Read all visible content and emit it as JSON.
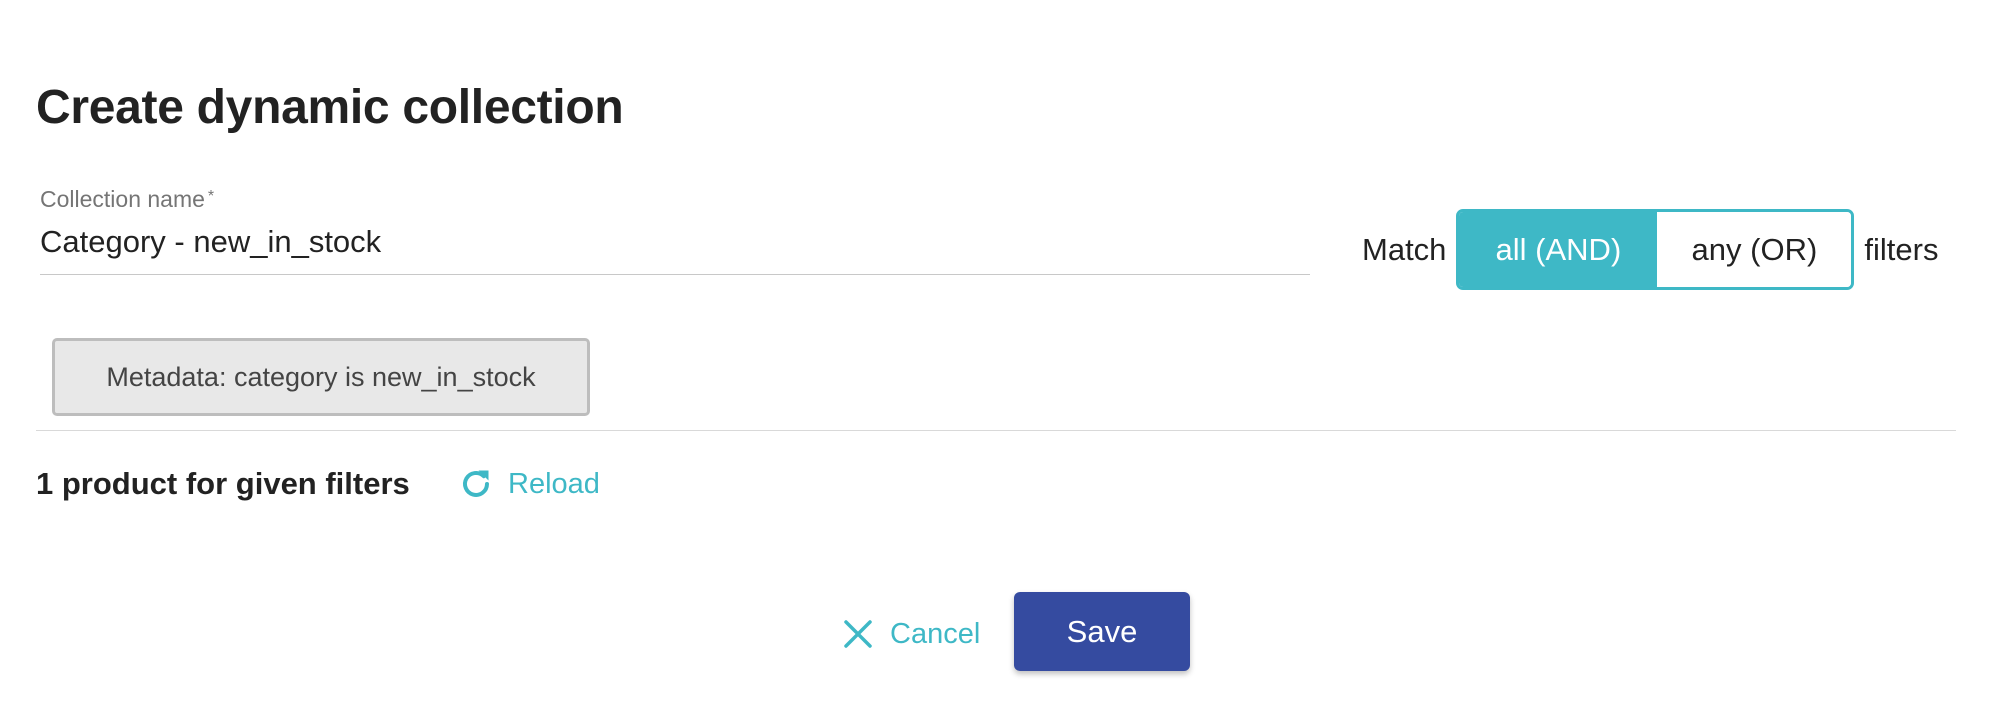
{
  "dialog": {
    "title": "Create dynamic collection"
  },
  "name_field": {
    "label": "Collection name",
    "required_mark": "*",
    "value": "Category - new_in_stock"
  },
  "match": {
    "prefix": "Match",
    "options": [
      {
        "label": "all (AND)",
        "selected": true
      },
      {
        "label": "any (OR)",
        "selected": false
      }
    ],
    "suffix": "filters"
  },
  "filters": [
    {
      "label": "Metadata: category is new_in_stock"
    }
  ],
  "results": {
    "count_text": "1 product for given filters",
    "reload_label": "Reload"
  },
  "actions": {
    "cancel_label": "Cancel",
    "save_label": "Save"
  },
  "colors": {
    "accent": "#3eb8c6",
    "primary": "#354ba0",
    "chip_bg": "#e8e8e8"
  },
  "icons": {
    "reload": "refresh-icon",
    "cancel": "close-icon"
  }
}
